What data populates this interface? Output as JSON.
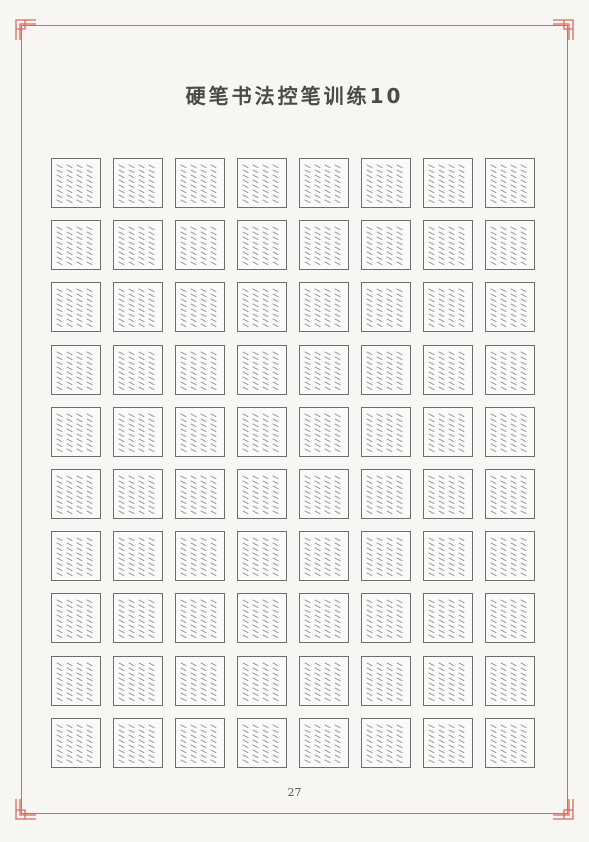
{
  "page": {
    "title": "硬笔书法控笔训练10",
    "page_number": "27"
  },
  "practice_grid": {
    "rows": 10,
    "columns": 8,
    "stroke_pattern": "diagonal-dash-icon",
    "dash_rows_per_cell": 8,
    "dashes_per_row": 4
  },
  "colors": {
    "frame": "#d9685e",
    "cell_border": "#6e6e6e",
    "dash": "#8a8a8a",
    "title": "#4a4a4a"
  }
}
